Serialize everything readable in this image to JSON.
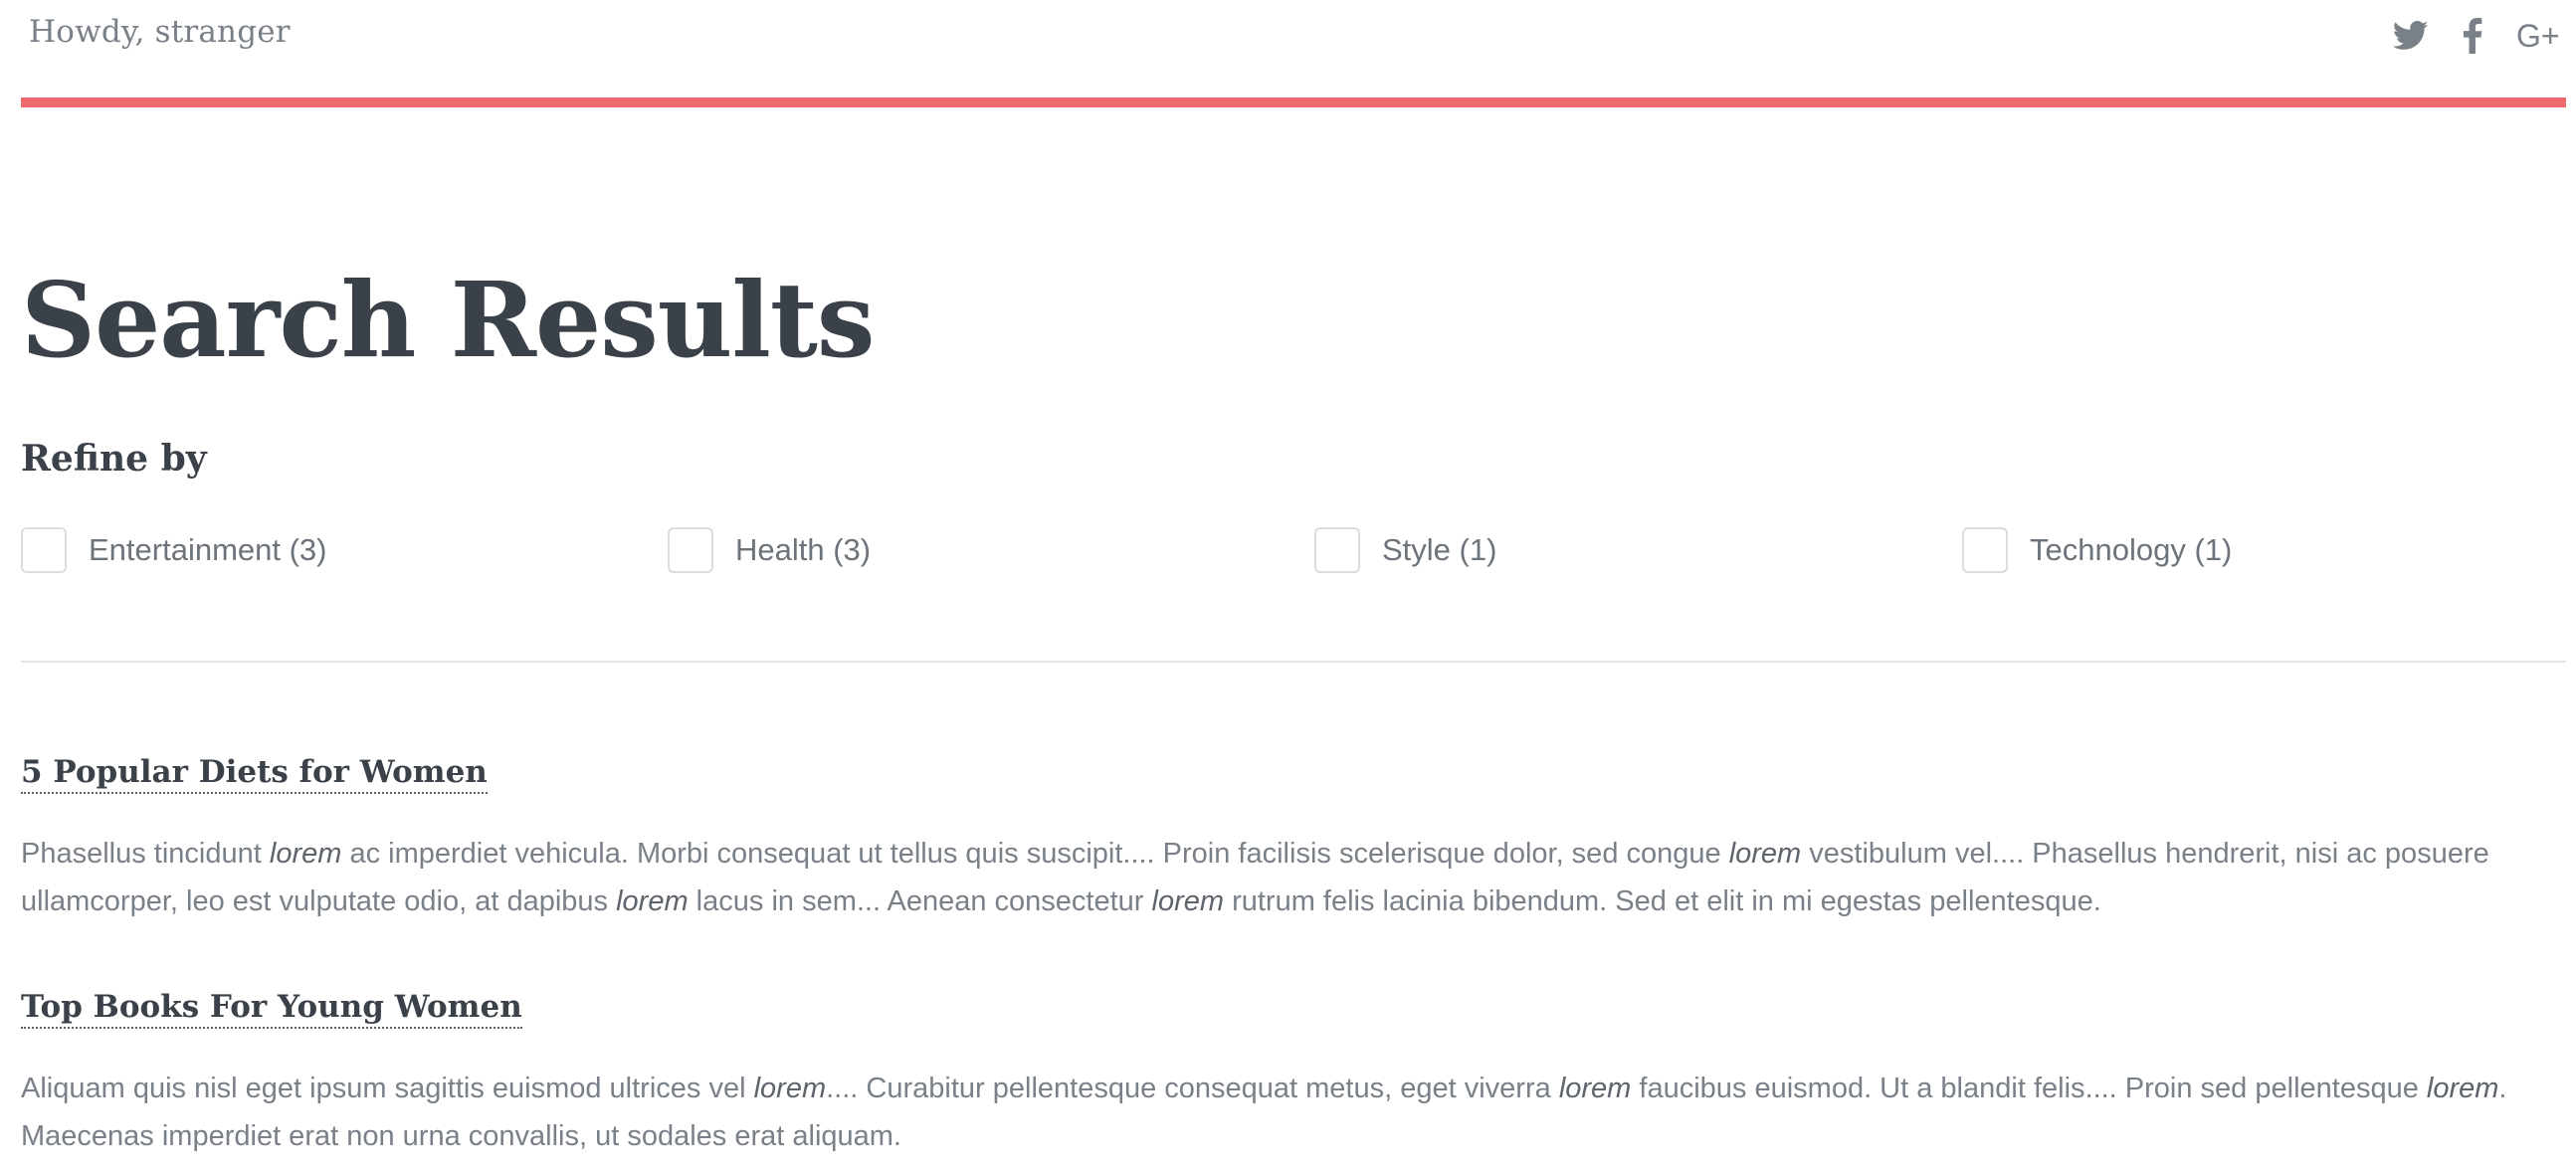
{
  "header": {
    "greeting": "Howdy, stranger",
    "social": [
      {
        "name": "twitter",
        "icon": "twitter-icon"
      },
      {
        "name": "facebook",
        "icon": "facebook-icon"
      },
      {
        "name": "google-plus",
        "icon": "google-plus-icon",
        "glyph": "G+"
      }
    ],
    "accent_color": "#ee6a6e"
  },
  "main": {
    "title": "Search Results",
    "refine_label": "Refine by",
    "filters": [
      {
        "label": "Entertainment (3)",
        "checked": false
      },
      {
        "label": "Health (3)",
        "checked": false
      },
      {
        "label": "Style (1)",
        "checked": false
      },
      {
        "label": "Technology (1)",
        "checked": false
      }
    ],
    "results": [
      {
        "title": "5 Popular Diets for Women",
        "excerpt": [
          {
            "t": "Phasellus tincidunt "
          },
          {
            "t": "lorem",
            "em": true
          },
          {
            "t": " ac imperdiet vehicula. Morbi consequat ut tellus quis suscipit.... Proin facilisis scelerisque dolor, sed congue "
          },
          {
            "t": "lorem",
            "em": true
          },
          {
            "t": " vestibulum vel.... Phasellus hendrerit, nisi ac posuere ullamcorper, leo est vulputate odio, at dapibus "
          },
          {
            "t": "lorem",
            "em": true
          },
          {
            "t": " lacus in sem... Aenean consectetur "
          },
          {
            "t": "lorem",
            "em": true
          },
          {
            "t": " rutrum felis lacinia bibendum. Sed et elit in mi egestas pellentesque."
          }
        ]
      },
      {
        "title": "Top Books For Young Women",
        "excerpt": [
          {
            "t": "Aliquam quis nisl eget ipsum sagittis euismod ultrices vel "
          },
          {
            "t": "lorem",
            "em": true
          },
          {
            "t": ".... Curabitur pellentesque consequat metus, eget viverra "
          },
          {
            "t": "lorem",
            "em": true
          },
          {
            "t": " faucibus euismod. Ut a blandit felis.... Proin sed pellentesque "
          },
          {
            "t": "lorem",
            "em": true
          },
          {
            "t": ". Maecenas imperdiet erat non urna convallis, ut sodales erat aliquam."
          }
        ]
      }
    ]
  }
}
